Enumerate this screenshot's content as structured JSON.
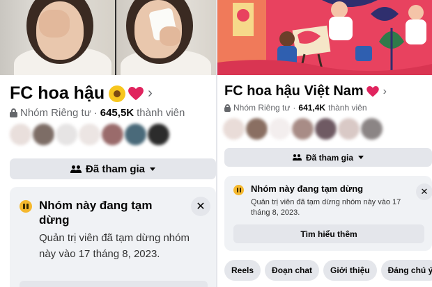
{
  "left": {
    "group": {
      "name": "FC hoa hậu",
      "privacy": "Nhóm Riêng tư",
      "separator": "·",
      "member_count": "645,5K",
      "member_suffix": "thành viên"
    },
    "avatar_colors": [
      "#e9dfdc",
      "#7d6d66",
      "#e6e4e4",
      "#ece5e3",
      "#9a6b6b",
      "#4a6a7a",
      "#2c2c2c"
    ],
    "join_button": "Đã tham gia",
    "notice": {
      "title": "Nhóm này đang tạm dừng",
      "body": "Quản trị viên đã tạm dừng nhóm này vào 17 tháng 8, 2023.",
      "close": "✕"
    }
  },
  "right": {
    "group": {
      "name": "FC hoa hậu Việt Nam",
      "privacy": "Nhóm Riêng tư",
      "separator": "·",
      "member_count": "641,4K",
      "member_suffix": "thành viên"
    },
    "avatar_colors": [
      "#e9dcd8",
      "#8a6f62",
      "#f3eeee",
      "#a88c86",
      "#6f5a63",
      "#d9c9c6",
      "#8b8585"
    ],
    "join_button": "Đã tham gia",
    "notice": {
      "title": "Nhóm này đang tạm dừng",
      "body": "Quản trị viên đã tạm dừng nhóm này vào 17 tháng 8, 2023.",
      "close": "✕",
      "learn_more": "Tìm hiểu thêm"
    },
    "chips": [
      "Reels",
      "Đoạn chat",
      "Giới thiệu",
      "Đáng chú ý"
    ]
  },
  "icons": {
    "chevron": "›",
    "sunflower": "sunflower-icon",
    "heart": "heart-icon",
    "lock": "lock-icon",
    "people": "people-icon",
    "pause": "pause-icon",
    "close": "close-icon"
  },
  "colors": {
    "button_bg": "#e4e6eb",
    "notice_bg": "#f0f2f5",
    "pause_icon": "#f5b82e",
    "heart": "#e0245e",
    "cover_right": "#e8425f",
    "secondary_text": "#65676b"
  }
}
